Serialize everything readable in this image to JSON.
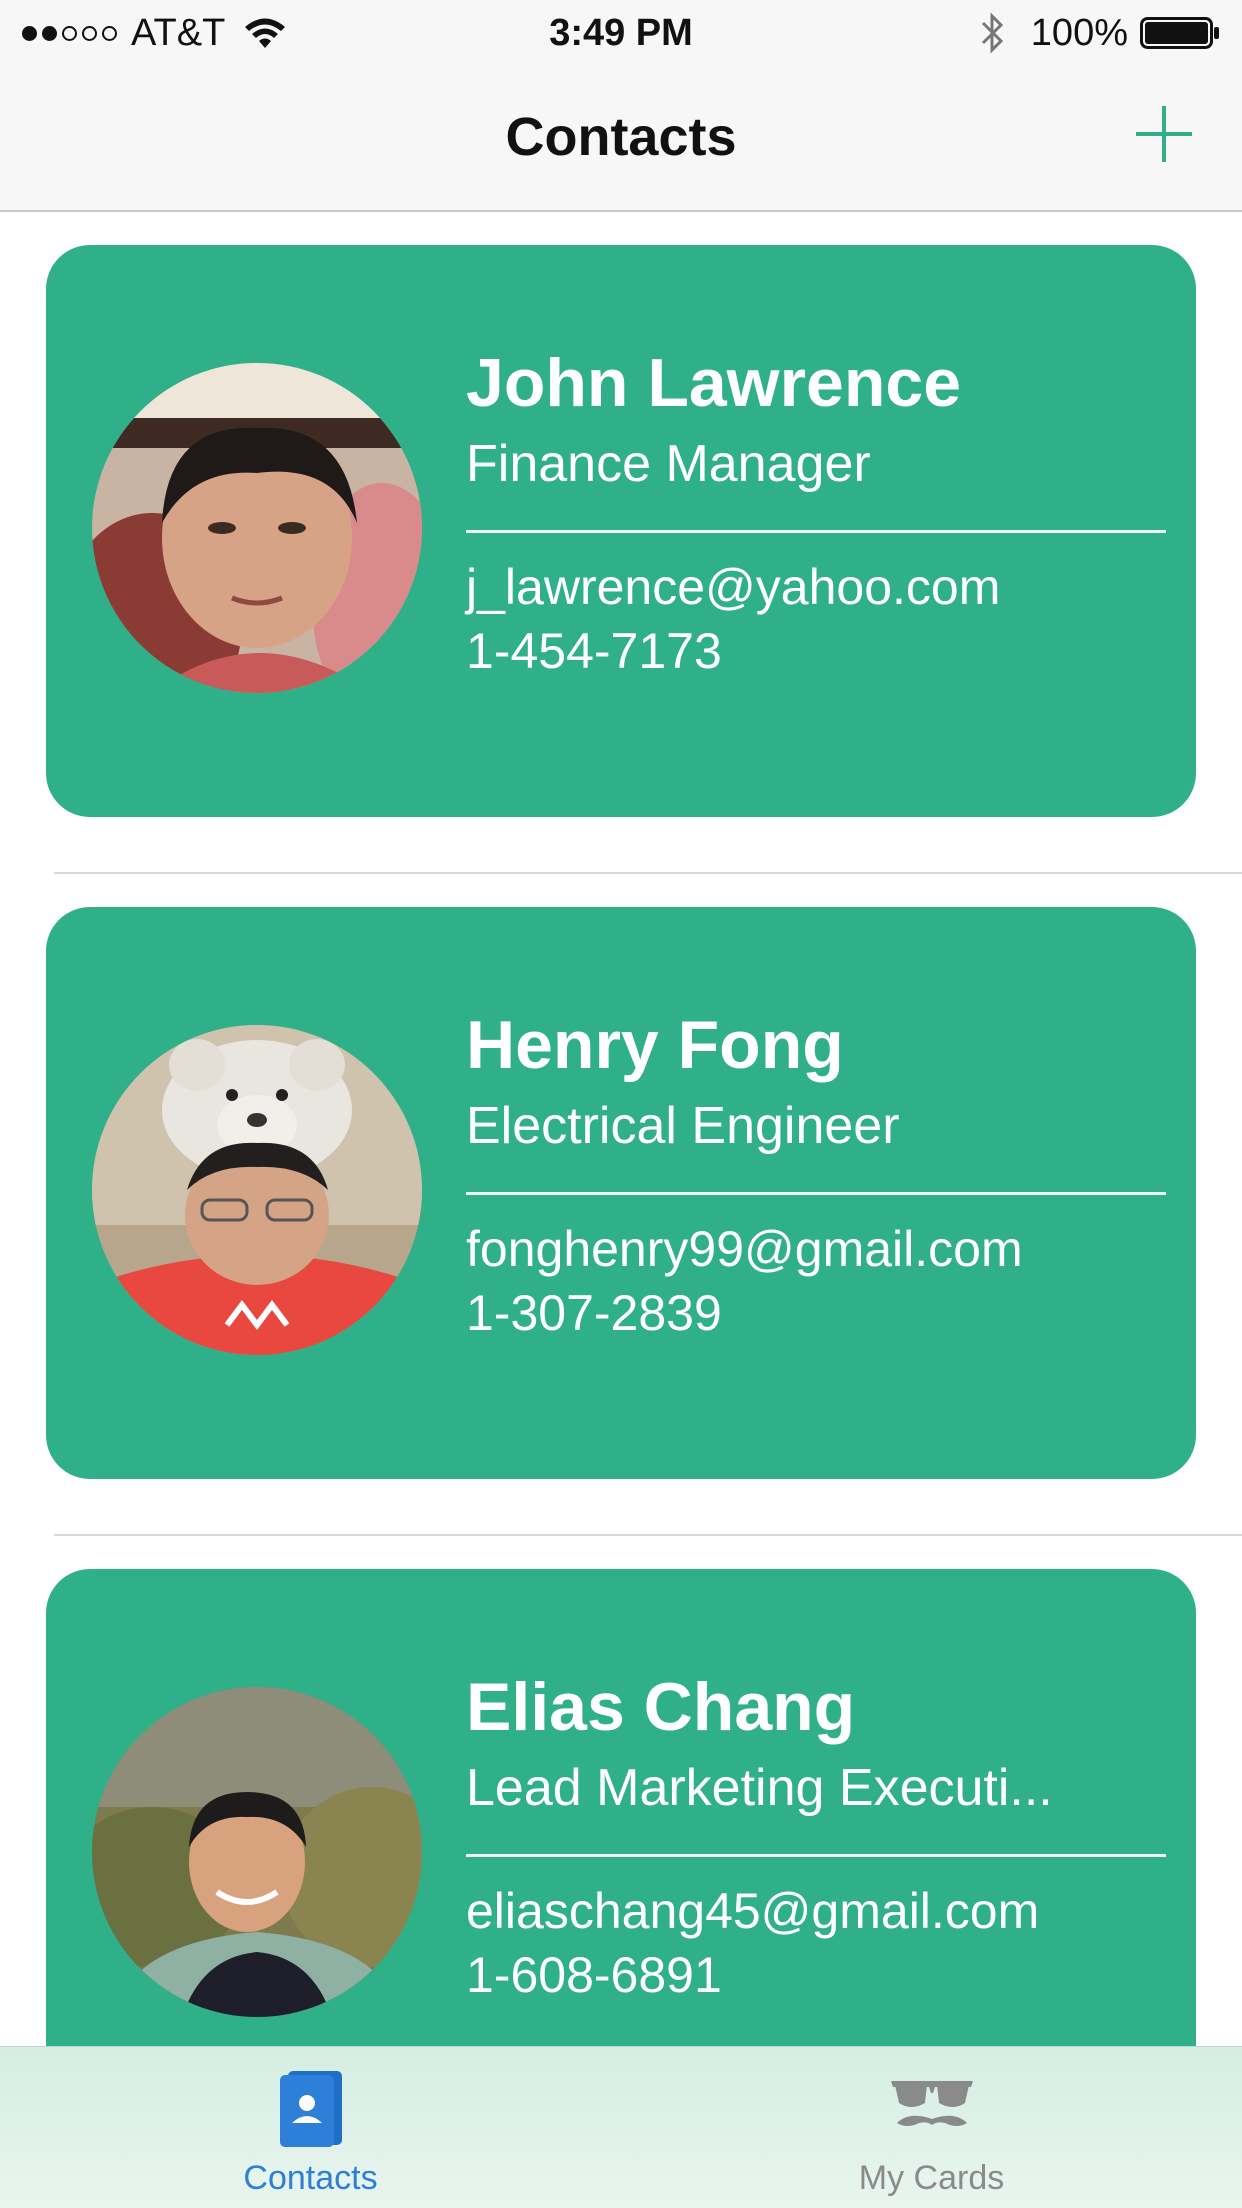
{
  "status_bar": {
    "carrier": "AT&T",
    "time": "3:49 PM",
    "battery": "100%",
    "signal_filled": 2,
    "signal_total": 5
  },
  "nav": {
    "title": "Contacts",
    "add_icon": "plus-icon"
  },
  "colors": {
    "card": "#2fb088",
    "accent": "#2fb088",
    "tab_active": "#2e7fd8",
    "tab_inactive": "#8a8a8a"
  },
  "contacts": [
    {
      "name": "John Lawrence",
      "title": "Finance Manager",
      "email": "j_lawrence@yahoo.com",
      "phone": "1-454-7173"
    },
    {
      "name": "Henry Fong",
      "title": "Electrical Engineer",
      "email": "fonghenry99@gmail.com",
      "phone": "1-307-2839"
    },
    {
      "name": "Elias Chang",
      "title": "Lead Marketing Executi...",
      "email": "eliaschang45@gmail.com",
      "phone": "1-608-6891"
    }
  ],
  "tabs": [
    {
      "label": "Contacts",
      "icon": "contacts-book-icon",
      "active": true
    },
    {
      "label": "My Cards",
      "icon": "sunglasses-mustache-icon",
      "active": false
    }
  ]
}
